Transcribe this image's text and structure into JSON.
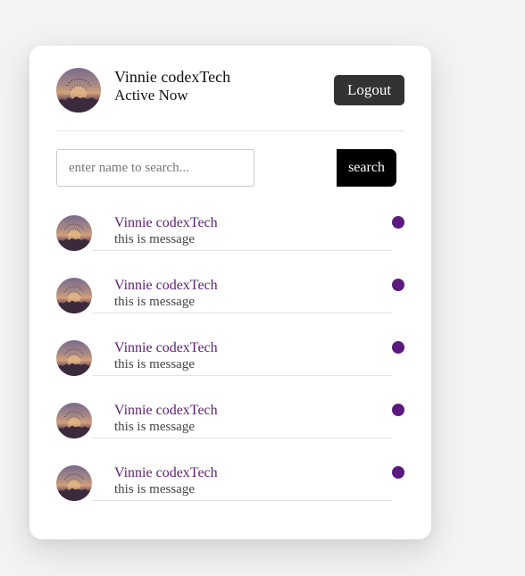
{
  "colors": {
    "online_dot": "#5b1a7e",
    "logout_bg": "#333333",
    "search_bg": "#000000",
    "name_color": "#5b1f73"
  },
  "header": {
    "name": "Vinnie codexTech",
    "status": "Active Now",
    "logout_label": "Logout",
    "avatar_icon": "profile-photo"
  },
  "search": {
    "placeholder": "enter name to search...",
    "value": "",
    "button_label": "search"
  },
  "users": [
    {
      "name": "Vinnie codexTech",
      "message": "this is message",
      "status": "online"
    },
    {
      "name": "Vinnie codexTech",
      "message": "this is message",
      "status": "online"
    },
    {
      "name": "Vinnie codexTech",
      "message": "this is message",
      "status": "online"
    },
    {
      "name": "Vinnie codexTech",
      "message": "this is message",
      "status": "online"
    },
    {
      "name": "Vinnie codexTech",
      "message": "this is message",
      "status": "online"
    }
  ]
}
